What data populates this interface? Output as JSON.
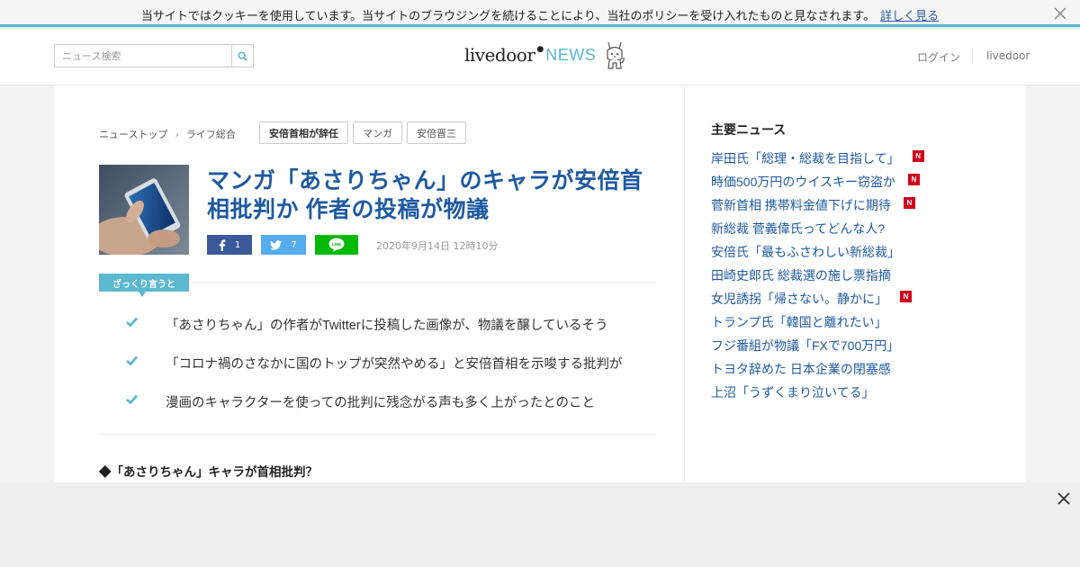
{
  "cookie_bar": {
    "message": "当サイトではクッキーを使用しています。当サイトのブラウジングを続けることにより、当社のポリシーを受け入れたものと見なされます。",
    "link_label": "詳しく見る"
  },
  "header": {
    "search_placeholder": "ニュース検索",
    "logo_livedoor": "livedoor",
    "logo_news": "NEWS",
    "login_label": "ログイン",
    "livedoor_label": "livedoor"
  },
  "breadcrumb": {
    "items": [
      "ニューストップ",
      "ライフ総合"
    ]
  },
  "tags": [
    "安倍首相が辞任",
    "マンガ",
    "安倍晋三"
  ],
  "article": {
    "title": "マンガ「あさりちゃん」のキャラが安倍首相批判か 作者の投稿が物議",
    "share_counts": {
      "facebook": "1",
      "twitter": "7"
    },
    "date": "2020年9月14日 12時10分",
    "summary_label": "ざっくり言うと",
    "summary_points": [
      "「あさりちゃん」の作者がTwitterに投稿した画像が、物議を醸しているそう",
      "「コロナ禍のさなかに国のトップが突然やめる」と安倍首相を示唆する批判が",
      "漫画のキャラクターを使っての批判に残念がる声も多く上がったとのこと"
    ],
    "subheading": "◆「あさりちゃん」キャラが首相批判？"
  },
  "sidebar": {
    "title": "主要ニュース",
    "items": [
      {
        "label": "岸田氏「総理・総裁を目指して」",
        "badge": "N"
      },
      {
        "label": "時価500万円のウイスキー窃盗か",
        "badge": "N"
      },
      {
        "label": "菅新首相 携帯料金値下げに期待",
        "badge": "N"
      },
      {
        "label": "新総裁 菅義偉氏ってどんな人?",
        "badge": ""
      },
      {
        "label": "安倍氏「最もふさわしい新総裁」",
        "badge": ""
      },
      {
        "label": "田崎史郎氏 総裁選の施し票指摘",
        "badge": ""
      },
      {
        "label": "女児誘拐「帰さない。静かに」",
        "badge": "N"
      },
      {
        "label": "トランプ氏「韓国と離れたい」",
        "badge": ""
      },
      {
        "label": "フジ番組が物議「FXで700万円」",
        "badge": ""
      },
      {
        "label": "トヨタ辞めた 日本企業の閉塞感",
        "badge": ""
      },
      {
        "label": "上沼「うずくまり泣いてる」",
        "badge": ""
      }
    ]
  },
  "colors": {
    "accent": "#5bb8cf",
    "title_blue": "#1f5aa0",
    "facebook": "#3b5998",
    "twitter": "#55acee",
    "line": "#00b900",
    "badge_red": "#d0021b"
  }
}
